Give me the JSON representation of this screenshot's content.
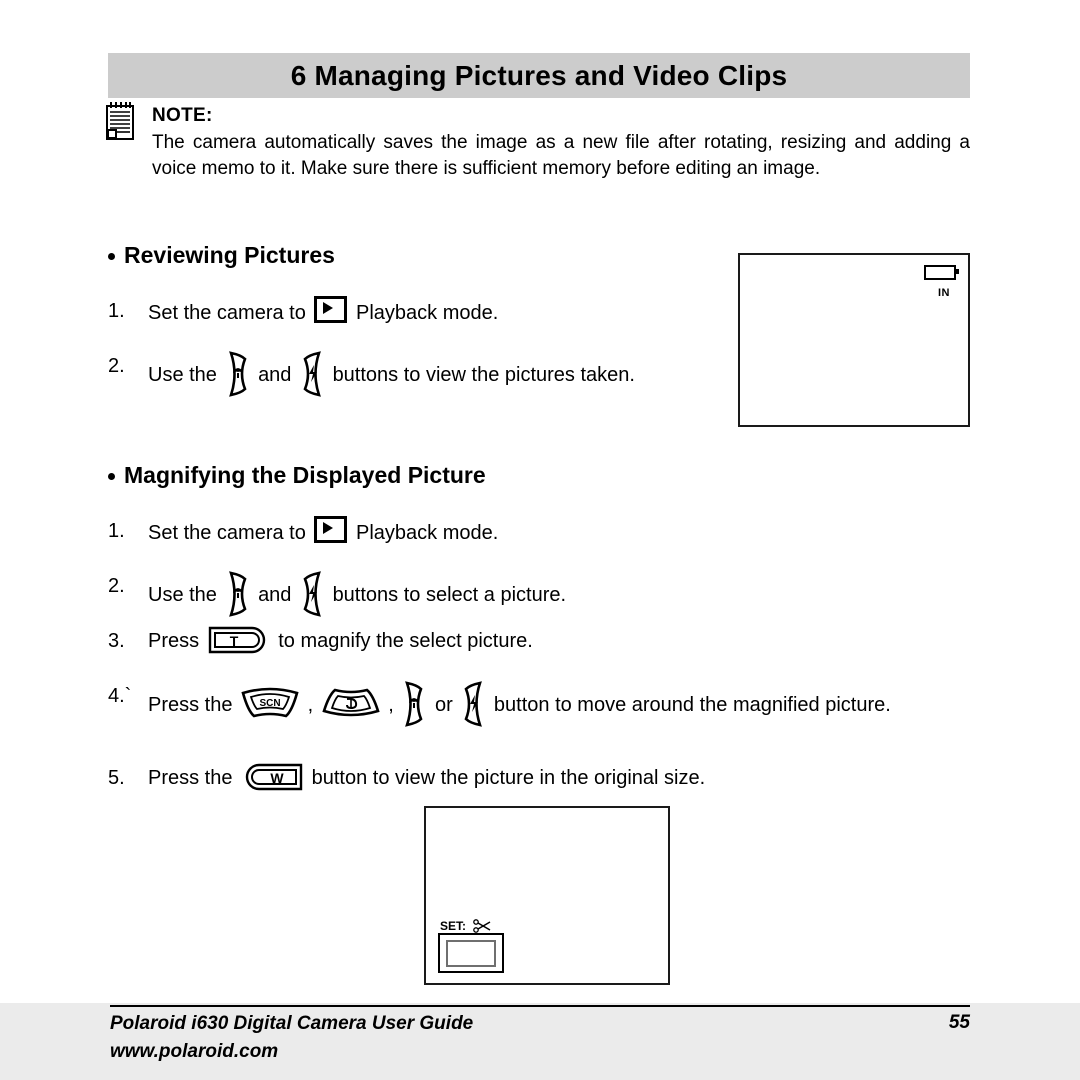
{
  "document": {
    "chapter": {
      "number": "6",
      "title": "6 Managing Pictures and Video Clips"
    },
    "note": {
      "icon": "notepad-icon",
      "label": "NOTE:",
      "body": "The camera automatically saves the image as a new file after rotating, resizing and adding a voice memo to it. Make sure there is sufficient memory before editing an image."
    },
    "sections": [
      {
        "id": "reviewing-pictures",
        "heading": "Reviewing Pictures",
        "steps": [
          {
            "number": "1.",
            "parts": [
              "Set the camera to ",
              "[playback-icon]",
              " Playback mode."
            ],
            "text_before": "Set the camera to",
            "text_after": "Playback mode."
          },
          {
            "number": "2.",
            "text_before": "Use the",
            "text_middle": "and",
            "text_after": "buttons to view the pictures taken."
          }
        ]
      },
      {
        "id": "magnifying-displayed-picture",
        "heading": "Magnifying the Displayed Picture",
        "steps": [
          {
            "number": "1.",
            "text_before": "Set the camera to",
            "text_after": "Playback mode."
          },
          {
            "number": "2.",
            "text_before": "Use the",
            "text_middle": "and",
            "text_after": "buttons to select a picture."
          },
          {
            "number": "3.",
            "text_before": "Press",
            "text_after": "to magnify the select picture."
          },
          {
            "number": "4.`",
            "text_before": "Press the",
            "comma1": ",",
            "comma2": ",",
            "text_or": "or",
            "text_after": "button to move around the magnified picture."
          },
          {
            "number": "5.",
            "text_before": "Press the",
            "text_after": "button to view the picture in the original size."
          }
        ]
      }
    ],
    "buttons": {
      "playback": "playback-mode-icon",
      "macro": "macro-left-button-icon",
      "flash": "flash-right-button-icon",
      "scene": "SCN",
      "self_timer": "self-timer-button-icon",
      "zoom_tele": "T",
      "zoom_wide": "W"
    },
    "lcd_top": {
      "battery": "battery-icon",
      "memory_label": "IN"
    },
    "lcd_bottom": {
      "set_label": "SET:",
      "crop_icon": "scissors-icon"
    },
    "footer": {
      "line1": "Polaroid i630 Digital Camera User Guide",
      "line2": "www.polaroid.com",
      "page_number": "55"
    },
    "colors": {
      "header_band": "#cccccc",
      "footer_band": "#ebebeb",
      "text": "#000000"
    }
  }
}
